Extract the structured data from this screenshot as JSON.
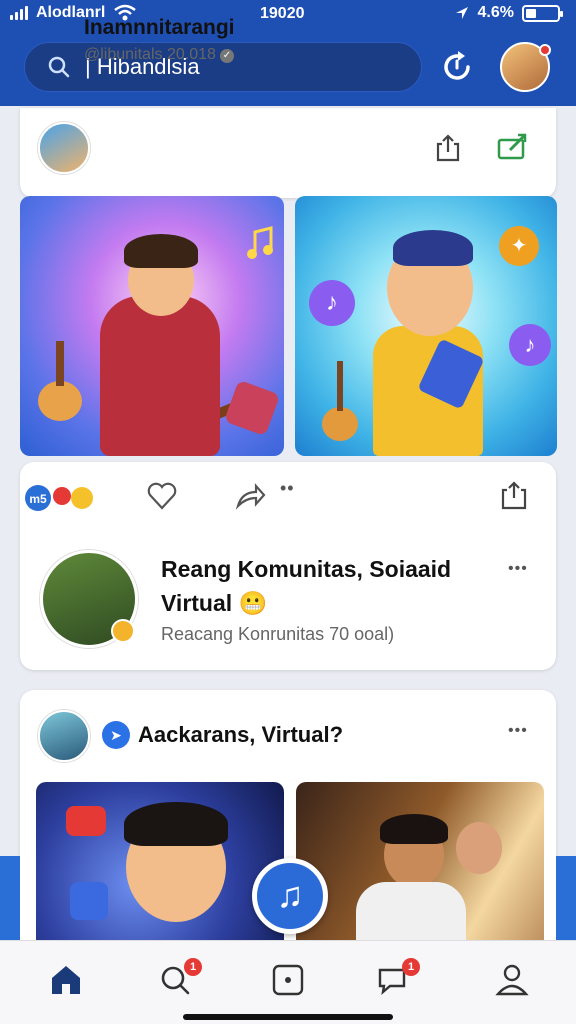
{
  "status_bar": {
    "carrier": "Alodlanrl",
    "time": "19020",
    "battery": "4.6%"
  },
  "search": {
    "text": "Hibandlsia",
    "icon": "search-icon"
  },
  "header_icons": {
    "refresh": "refresh-icon",
    "profile": "avatar"
  },
  "post1": {
    "name": "Inamnnitarangi",
    "handle": "@libunitals 20.018",
    "actions": [
      "share-icon",
      "edit-icon"
    ]
  },
  "post2": {
    "reactions": [
      "m5-badge",
      "heart-badge",
      "smile-badge"
    ],
    "title_line1": "Reang Komunitas, Soiaaid",
    "title_line2": "Virtual",
    "title_emoji": "😬",
    "subtitle": "Reacang Konrunitas 70 ooal)",
    "more": "•••"
  },
  "post3": {
    "title": "Aackarans, Virtual?",
    "more": "•••"
  },
  "fab": {
    "icon": "music-note-icon",
    "glyph": "♫"
  },
  "bottom_nav": {
    "items": [
      {
        "name": "home-tab",
        "badge": ""
      },
      {
        "name": "search-tab",
        "badge": "1"
      },
      {
        "name": "media-tab",
        "badge": ""
      },
      {
        "name": "messages-tab",
        "badge": "1"
      },
      {
        "name": "profile-tab",
        "badge": ""
      }
    ]
  },
  "colors": {
    "header": "#1e4fb3",
    "accent": "#2b6bd8",
    "badge": "#e53935"
  }
}
